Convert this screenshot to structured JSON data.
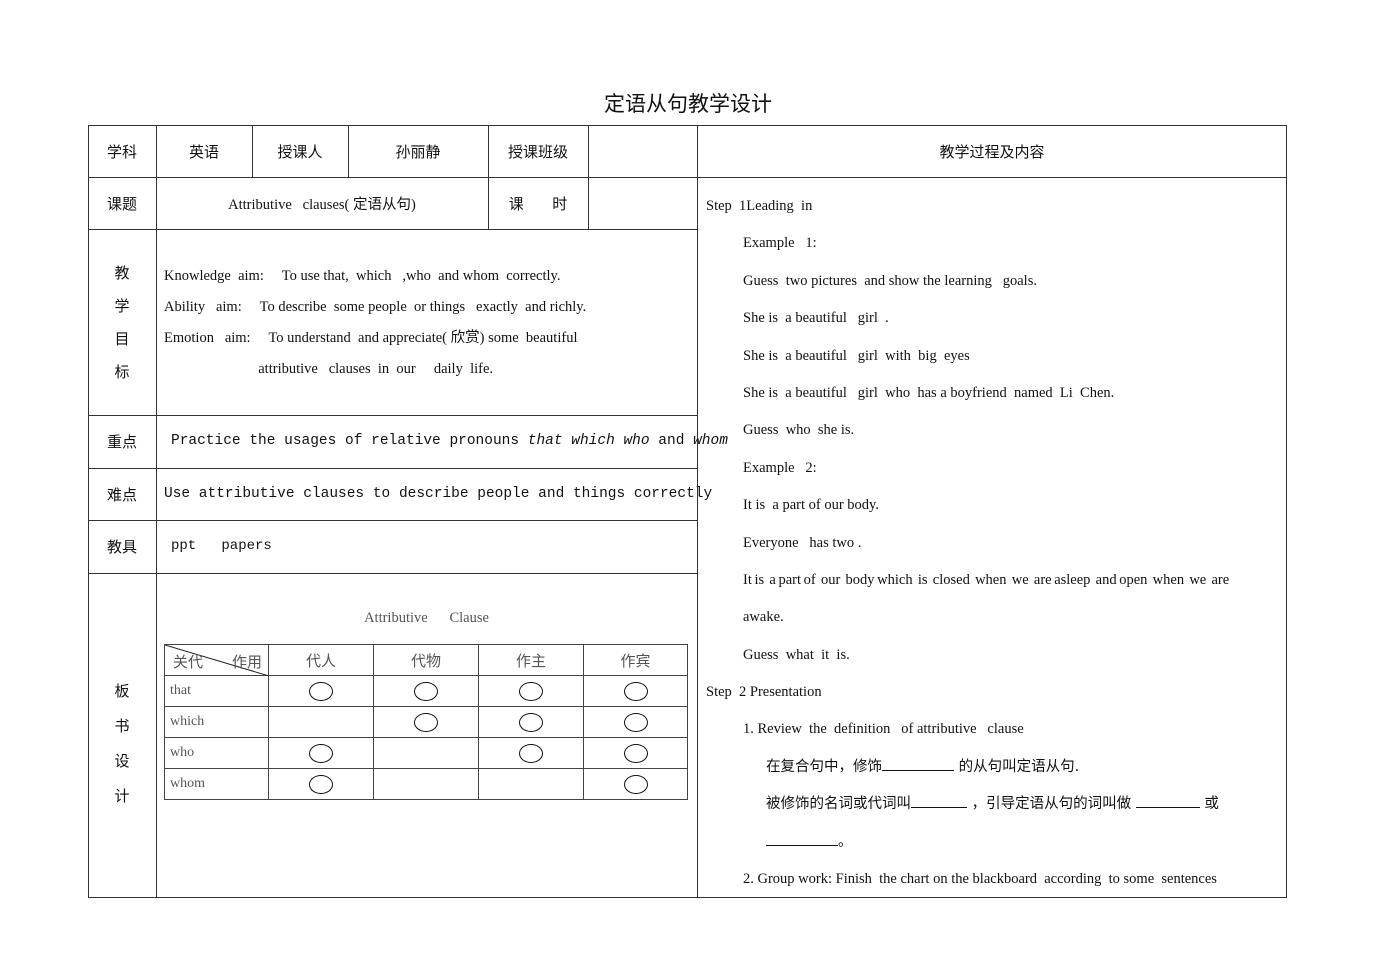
{
  "document": {
    "title": "定语从句教学设计"
  },
  "info_table": {
    "subject_label": "学科",
    "subject_value": "英语",
    "teacher_label": "授课人",
    "teacher_value": "孙丽静",
    "class_label": "授课班级",
    "class_value": "",
    "topic_label": "课题",
    "topic_value": "Attributive   clauses( 定语从句)",
    "hours_label": "课      时",
    "hours_value": "",
    "goals_label_chars": [
      "教",
      "学",
      "目",
      "标"
    ],
    "goals": [
      "Knowledge  aim:     To use that,  which   ,who  and whom  correctly.",
      "Ability   aim:     To describe  some people  or things   exactly  and richly.",
      "Emotion   aim:     To understand  and appreciate( 欣赏) some  beautiful",
      "                          attributive   clauses  in  our     daily  life."
    ],
    "key_point_label": "重点",
    "key_point_prefix": "Practice the usages of relative pronouns ",
    "key_point_pronouns_1": "that which who",
    "key_point_and": " and ",
    "key_point_pronouns_2": "whom",
    "difficulty_label": "难点",
    "difficulty_value": "Use attributive clauses to describe people and things correctly",
    "aids_label": "教具",
    "aids_value": "ppt   papers",
    "board_label_chars": [
      "板",
      "书",
      "设",
      "计"
    ]
  },
  "board_design": {
    "caption": "Attributive      Clause",
    "corner_left": "关代",
    "corner_right": "作用",
    "columns": [
      "代人",
      "代物",
      "作主",
      "作宾"
    ],
    "rows": [
      {
        "pronoun": "that",
        "marks": [
          true,
          true,
          true,
          true
        ]
      },
      {
        "pronoun": "which",
        "marks": [
          false,
          true,
          true,
          true
        ]
      },
      {
        "pronoun": "who",
        "marks": [
          true,
          false,
          true,
          true
        ]
      },
      {
        "pronoun": "whom",
        "marks": [
          true,
          false,
          false,
          true
        ]
      }
    ]
  },
  "process": {
    "header": "教学过程及内容",
    "lines": {
      "step1": "Step  1Leading  in",
      "ex1": "Example   1:",
      "l1": "Guess  two pictures  and show the learning   goals.",
      "l2": "She is  a beautiful   girl  .",
      "l3": "She is  a beautiful   girl  with  big  eyes",
      "l4": "She is  a beautiful   girl  who  has a boyfriend  named  Li  Chen.",
      "l5": "Guess  who  she is.",
      "ex2": "Example   2:",
      "l6": "It is  a part of our body.",
      "l7": "Everyone   has two .",
      "l8": "It is  a part of  our  body which  is  closed  when  we  are asleep  and open  when  we  are",
      "l9": "awake.",
      "l10": "Guess  what  it  is.",
      "step2": "Step  2 Presentation",
      "p1": "1. Review  the  definition   of attributive   clause",
      "cn1_a": "在复合句中，修饰",
      "cn1_b": " 的从句叫定语从句.",
      "cn2_a": "被修饰的名词或代词叫",
      "cn2_b": " ，引导定语从句的词叫做 ",
      "cn2_c": " 或",
      "cn3": "。",
      "p2": "2. Group work: Finish  the chart on the blackboard  according  to some  sentences"
    }
  }
}
